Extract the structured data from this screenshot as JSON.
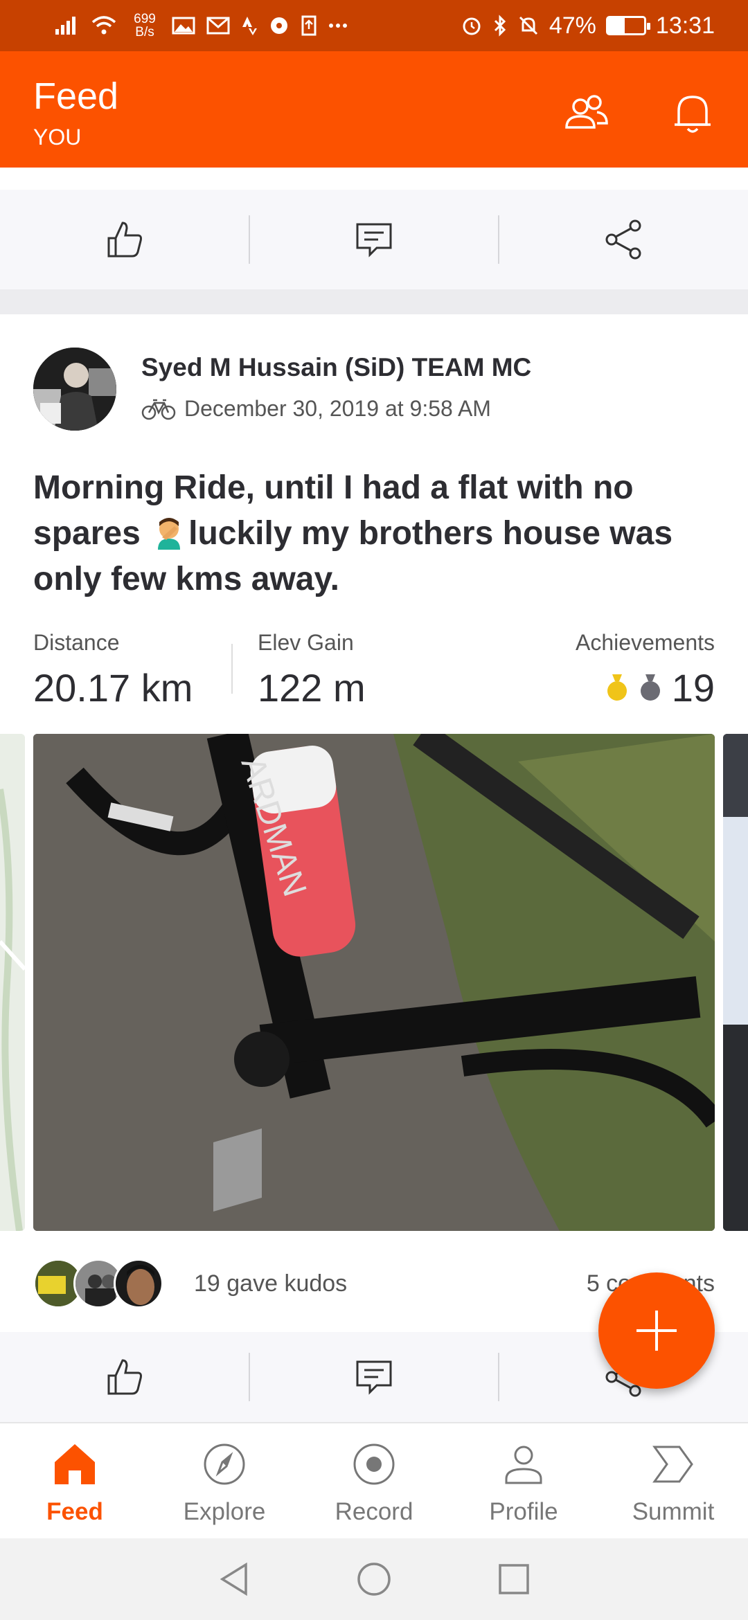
{
  "status_bar": {
    "speed_value": "699",
    "speed_unit": "B/s",
    "battery": "47%",
    "time": "13:31",
    "battery_level": 0.47
  },
  "header": {
    "title": "Feed",
    "subtitle": "YOU"
  },
  "activity": {
    "athlete_name": "Syed M Hussain (SiD) TEAM MC",
    "date": "December 30, 2019 at 9:58 AM",
    "title_part1": "Morning Ride, until I had a flat with no spares ",
    "title_part2": "luckily my brothers house was only few kms away.",
    "stats": {
      "distance_label": "Distance",
      "distance_value": "20.17 km",
      "elev_label": "Elev Gain",
      "elev_value": "122 m",
      "achievements_label": "Achievements",
      "achievements_value": "19"
    },
    "photo_text": "ARDMAN",
    "kudos_text": "19 gave kudos",
    "comments_text": "5 comments"
  },
  "tabs": [
    {
      "label": "Feed",
      "icon": "home-icon",
      "active": true
    },
    {
      "label": "Explore",
      "icon": "compass-icon",
      "active": false
    },
    {
      "label": "Record",
      "icon": "record-icon",
      "active": false
    },
    {
      "label": "Profile",
      "icon": "person-icon",
      "active": false
    },
    {
      "label": "Summit",
      "icon": "summit-icon",
      "active": false
    }
  ],
  "colors": {
    "brand": "#fc5200",
    "status_bar": "#c74100",
    "medal_gold": "#f0c419",
    "medal_silver": "#6b6b73"
  }
}
